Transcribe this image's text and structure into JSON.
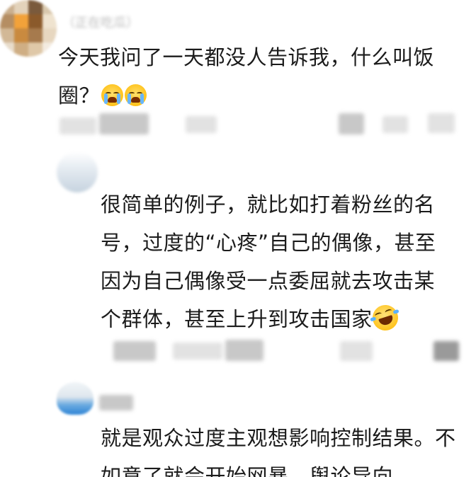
{
  "comments": [
    {
      "username": "（正在吃瓜）",
      "text": "今天我问了一天都没人告诉我，什么叫饭圈？",
      "emoji": [
        "loudly-crying-face",
        "loudly-crying-face"
      ]
    },
    {
      "username": "",
      "text": "很简单的例子，就比如打着粉丝的名号，过度的“心疼”自己的偶像，甚至因为自己偶像受一点委屈就去攻击某个群体，甚至上升到攻击国家",
      "emoji": [
        "rolling-on-floor-laughing-face"
      ]
    },
    {
      "username": "",
      "text": "就是观众过度主观想影响控制结果。不如意了就会开始网暴。舆论导向。",
      "emoji": []
    }
  ],
  "colors": {
    "text": "#1b1b1b",
    "redacted": "#c8c8c8",
    "emoji_yellow": "#ffc21a",
    "tear_blue": "#67b6ff"
  }
}
